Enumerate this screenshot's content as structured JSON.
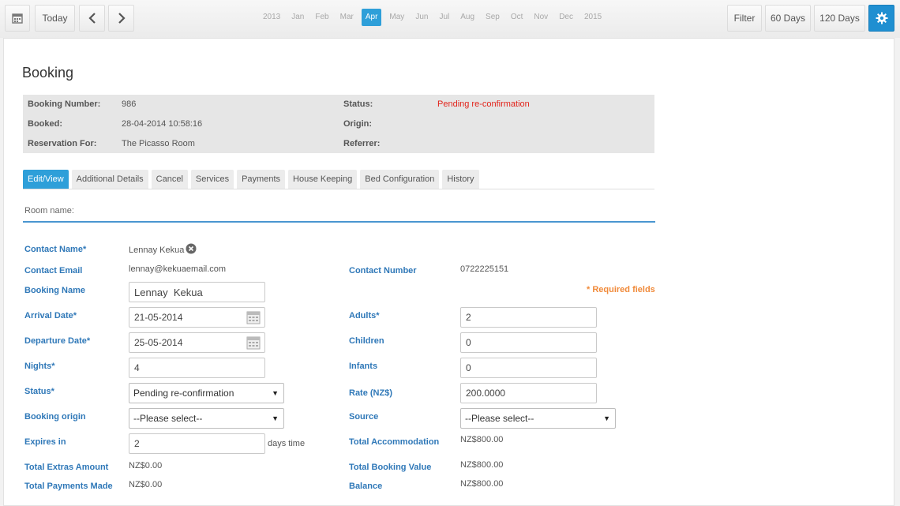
{
  "toolbar": {
    "today_label": "Today",
    "months": [
      "2013",
      "Jan",
      "Feb",
      "Mar",
      "Apr",
      "May",
      "Jun",
      "Jul",
      "Aug",
      "Sep",
      "Oct",
      "Nov",
      "Dec",
      "2015"
    ],
    "active_month": "Apr",
    "filter_label": "Filter",
    "days60_label": "60 Days",
    "days120_label": "120 Days",
    "accent_color": "#2e9fd9"
  },
  "page": {
    "title": "Booking"
  },
  "summary": {
    "booking_number_label": "Booking Number:",
    "booking_number": "986",
    "booked_label": "Booked:",
    "booked": "28-04-2014 10:58:16",
    "reservation_label": "Reservation For:",
    "reservation": "The Picasso Room",
    "status_label": "Status:",
    "status": "Pending re-confirmation",
    "status_color": "#e2231a",
    "origin_label": "Origin:",
    "referrer_label": "Referrer:"
  },
  "tabs": [
    "Edit/View",
    "Additional Details",
    "Cancel",
    "Services",
    "Payments",
    "House Keeping",
    "Bed Configuration",
    "History"
  ],
  "active_tab": "Edit/View",
  "room_name_label": "Room name:",
  "required_note": "* Required fields",
  "form": {
    "contact_name_label": "Contact Name*",
    "contact_name": "Lennay Kekua",
    "contact_email_label": "Contact Email",
    "contact_email": "lennay@kekuaemail.com",
    "contact_number_label": "Contact Number",
    "contact_number": "0722225151",
    "booking_name_label": "Booking Name",
    "booking_name": "Lennay  Kekua",
    "arrival_label": "Arrival Date*",
    "arrival": "21-05-2014",
    "departure_label": "Departure Date*",
    "departure": "25-05-2014",
    "nights_label": "Nights*",
    "nights": "4",
    "status_label": "Status*",
    "status": "Pending re-confirmation",
    "booking_origin_label": "Booking origin",
    "booking_origin": "--Please select--",
    "expires_label": "Expires in",
    "expires": "2",
    "expires_suffix": "days time",
    "adults_label": "Adults*",
    "adults": "2",
    "children_label": "Children",
    "children": "0",
    "infants_label": "Infants",
    "infants": "0",
    "rate_label": "Rate (NZ$)",
    "rate": "200.0000",
    "source_label": "Source",
    "source": "--Please select--",
    "total_accommodation_label": "Total Accommodation",
    "total_accommodation": "NZ$800.00",
    "total_extras_label": "Total Extras Amount",
    "total_extras": "NZ$0.00",
    "total_booking_label": "Total Booking Value",
    "total_booking": "NZ$800.00",
    "total_payments_label": "Total Payments Made",
    "total_payments": "NZ$0.00",
    "balance_label": "Balance",
    "balance": "NZ$800.00"
  }
}
